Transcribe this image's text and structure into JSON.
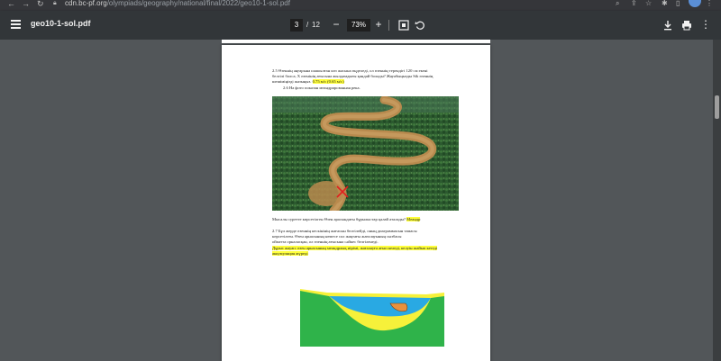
{
  "browser": {
    "back_icon": "arrow-left-icon",
    "forward_icon": "arrow-right-icon",
    "reload_icon": "reload-icon",
    "url_host": "cdn.bc-pf.org",
    "url_path": "/olympiads/geography/national/final/2022/geo10-1-sol.pdf",
    "right_icons": [
      "search-icon",
      "share-icon",
      "star-icon",
      "extensions-icon",
      "sidebar-icon",
      "profile-avatar"
    ]
  },
  "toolbar": {
    "file_name": "geo10-1-sol.pdf",
    "current_page": "3",
    "page_separator": "/",
    "total_pages": "12",
    "zoom_out": "−",
    "zoom_level": "73%",
    "zoom_in": "+",
    "fit_icon": "fit-page-icon",
    "rotate_icon": "rotate-icon",
    "download_icon": "download-icon",
    "print_icon": "print-icon",
    "more_icon": "more-vert-icon"
  },
  "document": {
    "q25_line1": "2.5 Өзеннің аңғарына шашылған көз жасына өңделеді, ол өзеннің терендігі 120 см екені",
    "q25_line2": "белгілі болса, Х өзенінің ағысына жылдамдығы қандай болады? Жауабыңызды Sik өзеннің",
    "q25_line3": "шешіміңізді жазыңыз.",
    "q25_answer": "0.75 м/с (0.65 м/с)",
    "q26_heading": "2.6 На фото показан меандрированная река.",
    "q26_question": "Мысалы суретте көрсетілген Өзен арасындағы бұрылыстар қалай аталады?",
    "q26_answer": "Меандр",
    "q27_line1": "2.7 Бұл жерде өзеннің кескінінің жағасын белгілейді, оның диаграммасын тамасы",
    "q27_line2": "көрсетілген. Өзен арнасының немесе сол жақтағы жағалауының сызбасы",
    "q27_line3": "ойпатта орналасқан, ол өзеннің ағысына сәйкес белгіленеді.",
    "q27_answer1": "Дұрыс жауап: өзен арнасының меандрлық иірімі, жағалауға ағып келеді, келуін шайып кетеді",
    "q27_answer2": "аккумуляция жүреді"
  },
  "colors": {
    "highlight": "#ffff3a",
    "diagram_green": "#2fb34a",
    "diagram_yellow": "#f6f13a",
    "diagram_blue": "#29a9e3",
    "diagram_sediment": "#e8913e"
  }
}
